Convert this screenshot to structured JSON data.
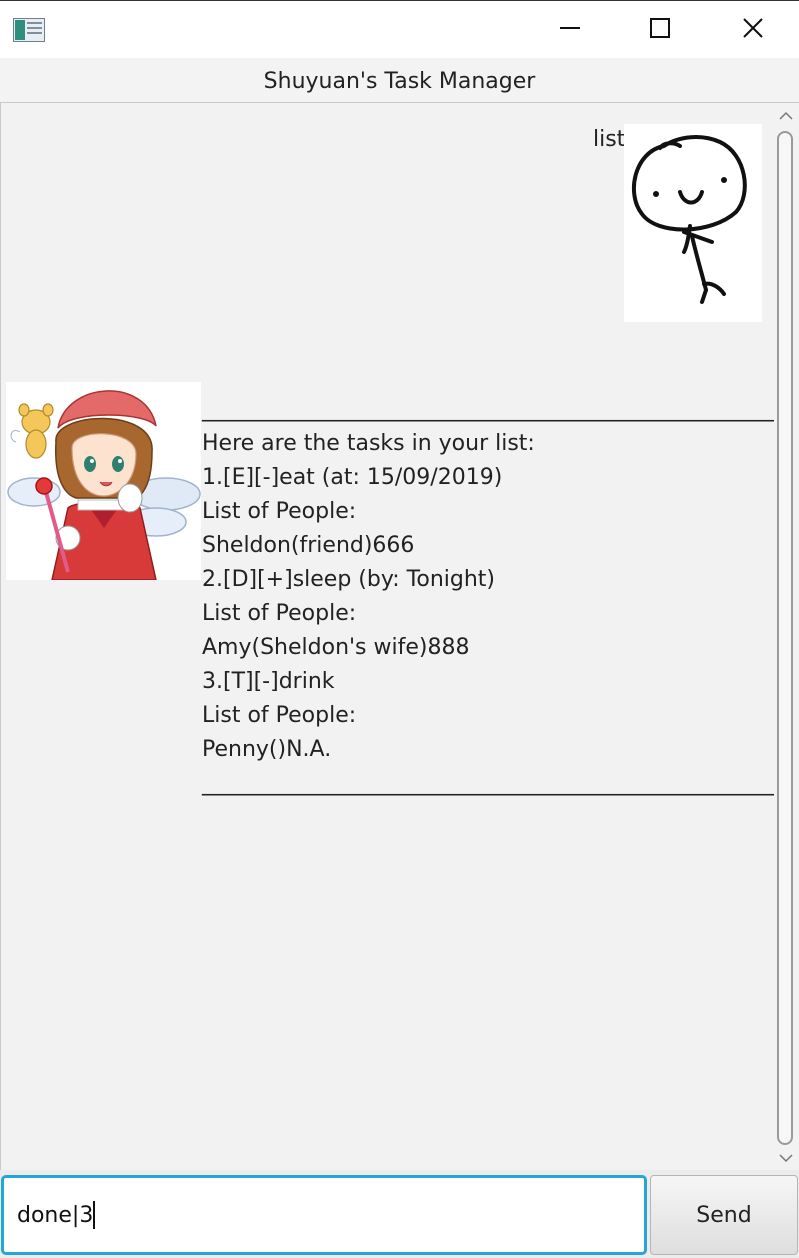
{
  "window": {
    "title": "Shuyuan's Task Manager"
  },
  "dialog": {
    "user_message": "list",
    "bot_message": "____________________________________________________\nHere are the tasks in your list:\n1.[E][-]eat (at: 15/09/2019)\nList of People:\nSheldon(friend)666\n2.[D][+]sleep (by: Tonight)\nList of People:\nAmy(Sheldon's wife)888\n3.[T][-]drink\nList of People:\nPenny()N.A.\n____________________________________________________"
  },
  "input": {
    "value": "done|3"
  },
  "send": {
    "label": "Send"
  },
  "colors": {
    "input_focus_border": "#26a5d9",
    "background": "#f2f2f2"
  },
  "icons": {
    "app": "app-icon",
    "minimize": "minimize-icon",
    "maximize": "maximize-icon",
    "close": "close-icon",
    "user_avatar": "stick-figure-avatar",
    "bot_avatar": "anime-girl-avatar"
  }
}
